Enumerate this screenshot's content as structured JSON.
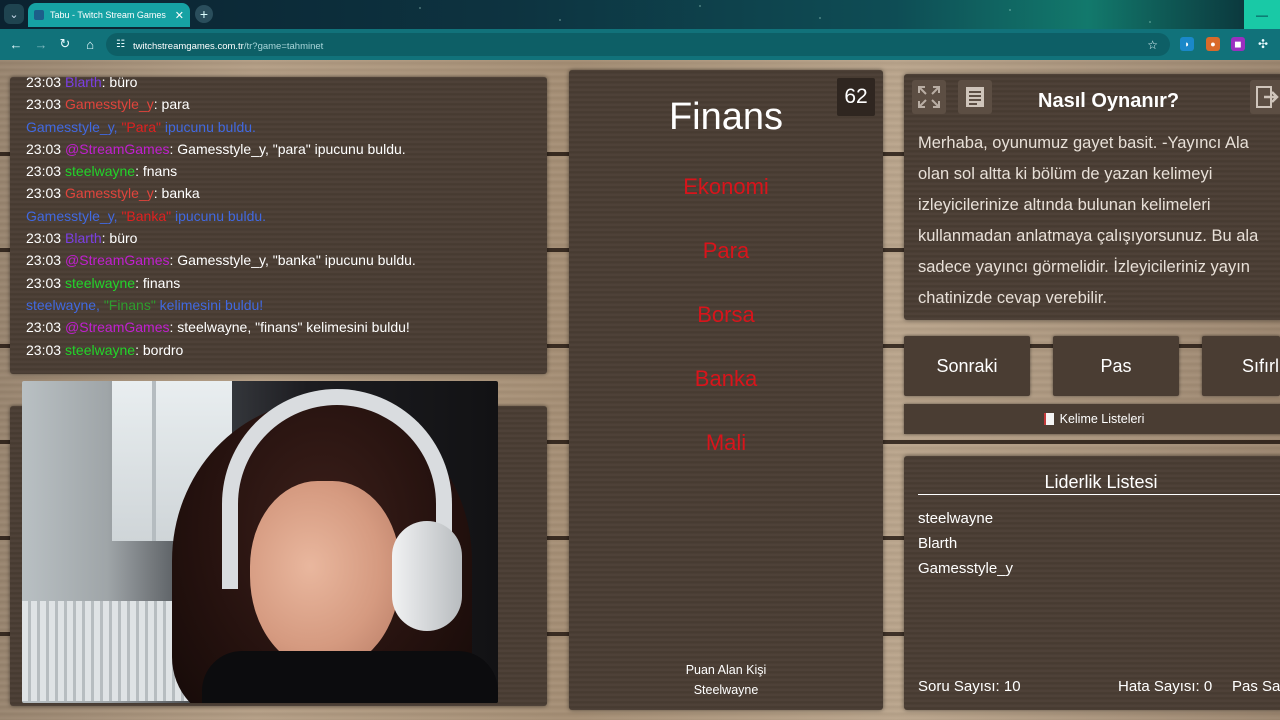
{
  "browser": {
    "tab_title": "Tabu - Twitch Stream Games",
    "url_host": "twitchstreamgames.com.tr",
    "url_path": "/tr?game=tahminet"
  },
  "chat": {
    "colors": {
      "time": "#ffffff",
      "gamesstyle": "#e0443c",
      "streamgames": "#c11fd0",
      "steelwayne": "#22d42a",
      "blarth": "#7b3fe4",
      "notice": "#4169e1"
    },
    "lines": [
      {
        "time": "23:03",
        "user": "Blarth",
        "msg": "büro"
      },
      {
        "time": "23:03",
        "user": "Gamesstyle_y",
        "msg": "para"
      },
      {
        "notice_user": "Gamesstyle_y, ",
        "notice_word": "\"Para\"",
        "notice_rest": " ipucunu buldu."
      },
      {
        "time": "23:03",
        "user": "@StreamGames",
        "msg": "Gamesstyle_y, \"para\" ipucunu buldu."
      },
      {
        "time": "23:03",
        "user": "steelwayne",
        "msg": "fnans"
      },
      {
        "time": "23:03",
        "user": "Gamesstyle_y",
        "msg": "banka"
      },
      {
        "notice_user": "Gamesstyle_y, ",
        "notice_word": "\"Banka\"",
        "notice_rest": " ipucunu buldu."
      },
      {
        "time": "23:03",
        "user": "Blarth",
        "msg": "büro"
      },
      {
        "time": "23:03",
        "user": "@StreamGames",
        "msg": "Gamesstyle_y, \"banka\" ipucunu buldu."
      },
      {
        "time": "23:03",
        "user": "steelwayne",
        "msg": "finans"
      },
      {
        "notice_user": "steelwayne, ",
        "notice_word": "\"Finans\"",
        "notice_rest": " kelimesini buldu!"
      },
      {
        "time": "23:03",
        "user": "@StreamGames",
        "msg": "steelwayne, \"finans\" kelimesini buldu!"
      },
      {
        "time": "23:03",
        "user": "steelwayne",
        "msg": "bordro"
      }
    ]
  },
  "game": {
    "timer": "62",
    "word": "Finans",
    "forbidden": [
      "Ekonomi",
      "Para",
      "Borsa",
      "Banka",
      "Mali"
    ],
    "scorer_title": "Puan Alan Kişi",
    "scorer_name": "Steelwayne"
  },
  "help": {
    "title": "Nasıl Oynanır?",
    "text": "Merhaba, oyunumuz gayet basit. -Yayıncı Ala\nolan sol altta ki bölüm de yazan kelimeyi\nizleyicilerinize altında bulunan kelimeleri\nkullanmadan anlatmaya çalışıyorsunuz. Bu ala\nsadece yayıncı görmelidir. İzleyicileriniz yayın\nchatinizde cevap verebilir."
  },
  "controls": {
    "next": "Sonraki",
    "pass": "Pas",
    "reset": "Sıfırl",
    "word_lists": "Kelime Listeleri"
  },
  "leaderboard": {
    "title": "Liderlik Listesi",
    "players": [
      "steelwayne",
      "Blarth",
      "Gamesstyle_y"
    ],
    "question_count_label": "Soru Sayısı:",
    "question_count": "10",
    "error_count_label": "Hata Sayısı:",
    "error_count": "0",
    "pass_count_label": "Pas Say"
  }
}
